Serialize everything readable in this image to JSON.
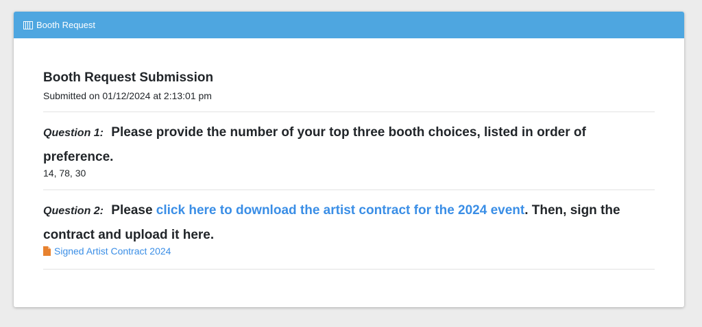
{
  "header": {
    "title": "Booth Request",
    "icon": "booth-icon",
    "color": "#4ea6e0"
  },
  "submission": {
    "title": "Booth Request Submission",
    "submitted": "Submitted on 01/12/2024 at 2:13:01 pm"
  },
  "questions": [
    {
      "number": "Question 1:",
      "text": "Please provide the number of your top three booth choices, listed in order of preference.",
      "answer": "14, 78, 30"
    },
    {
      "number": "Question 2:",
      "text_before": "Please ",
      "link_text": "click here to download the artist contract for the 2024 event",
      "text_after": ". Then, sign the contract and upload it here.",
      "file_icon": "document-icon",
      "file_name": "Signed Artist Contract 2024"
    }
  ],
  "colors": {
    "link": "#3a8ee6",
    "file_icon": "#e8822f"
  }
}
